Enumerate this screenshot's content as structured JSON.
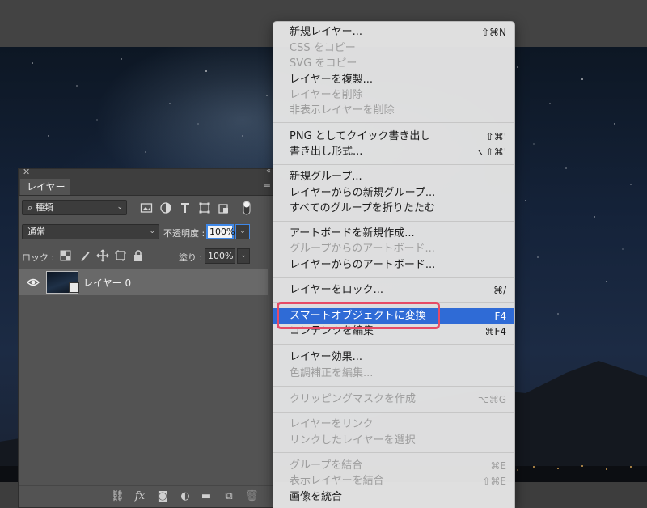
{
  "panel": {
    "tab_label": "レイヤー",
    "filter_select": "種類",
    "blend_mode": "通常",
    "opacity_label": "不透明度 :",
    "opacity_value": "100%",
    "lock_label": "ロック :",
    "fill_label": "塗り :",
    "fill_value": "100%",
    "layer_name": "レイヤー 0"
  },
  "menu": {
    "items": [
      {
        "label": "新規レイヤー...",
        "shortcut": "⇧⌘N",
        "disabled": false
      },
      {
        "label": "CSS をコピー",
        "shortcut": "",
        "disabled": true
      },
      {
        "label": "SVG をコピー",
        "shortcut": "",
        "disabled": true
      },
      {
        "label": "レイヤーを複製...",
        "shortcut": "",
        "disabled": false
      },
      {
        "label": "レイヤーを削除",
        "shortcut": "",
        "disabled": true
      },
      {
        "label": "非表示レイヤーを削除",
        "shortcut": "",
        "disabled": true
      },
      {
        "label": "PNG としてクイック書き出し",
        "shortcut": "⇧⌘'",
        "disabled": false
      },
      {
        "label": "書き出し形式...",
        "shortcut": "⌥⇧⌘'",
        "disabled": false
      },
      {
        "label": "新規グループ...",
        "shortcut": "",
        "disabled": false
      },
      {
        "label": "レイヤーからの新規グループ...",
        "shortcut": "",
        "disabled": false
      },
      {
        "label": "すべてのグループを折りたたむ",
        "shortcut": "",
        "disabled": false
      },
      {
        "label": "アートボードを新規作成...",
        "shortcut": "",
        "disabled": false
      },
      {
        "label": "グループからのアートボード...",
        "shortcut": "",
        "disabled": true
      },
      {
        "label": "レイヤーからのアートボード...",
        "shortcut": "",
        "disabled": false
      },
      {
        "label": "レイヤーをロック...",
        "shortcut": "⌘/",
        "disabled": false
      },
      {
        "label": "スマートオブジェクトに変換",
        "shortcut": "F4",
        "disabled": false,
        "selected": true
      },
      {
        "label": "コンテンツを編集",
        "shortcut": "⌘F4",
        "disabled": false
      },
      {
        "label": "レイヤー効果...",
        "shortcut": "",
        "disabled": false
      },
      {
        "label": "色調補正を編集...",
        "shortcut": "",
        "disabled": true
      },
      {
        "label": "クリッピングマスクを作成",
        "shortcut": "⌥⌘G",
        "disabled": true
      },
      {
        "label": "レイヤーをリンク",
        "shortcut": "",
        "disabled": true
      },
      {
        "label": "リンクしたレイヤーを選択",
        "shortcut": "",
        "disabled": true
      },
      {
        "label": "グループを結合",
        "shortcut": "⌘E",
        "disabled": true
      },
      {
        "label": "表示レイヤーを結合",
        "shortcut": "⇧⌘E",
        "disabled": true
      },
      {
        "label": "画像を統合",
        "shortcut": "",
        "disabled": false
      }
    ]
  },
  "colors": {
    "selection": "#2f6bd6",
    "callout": "#e64b66",
    "panel_bg": "#535353"
  }
}
